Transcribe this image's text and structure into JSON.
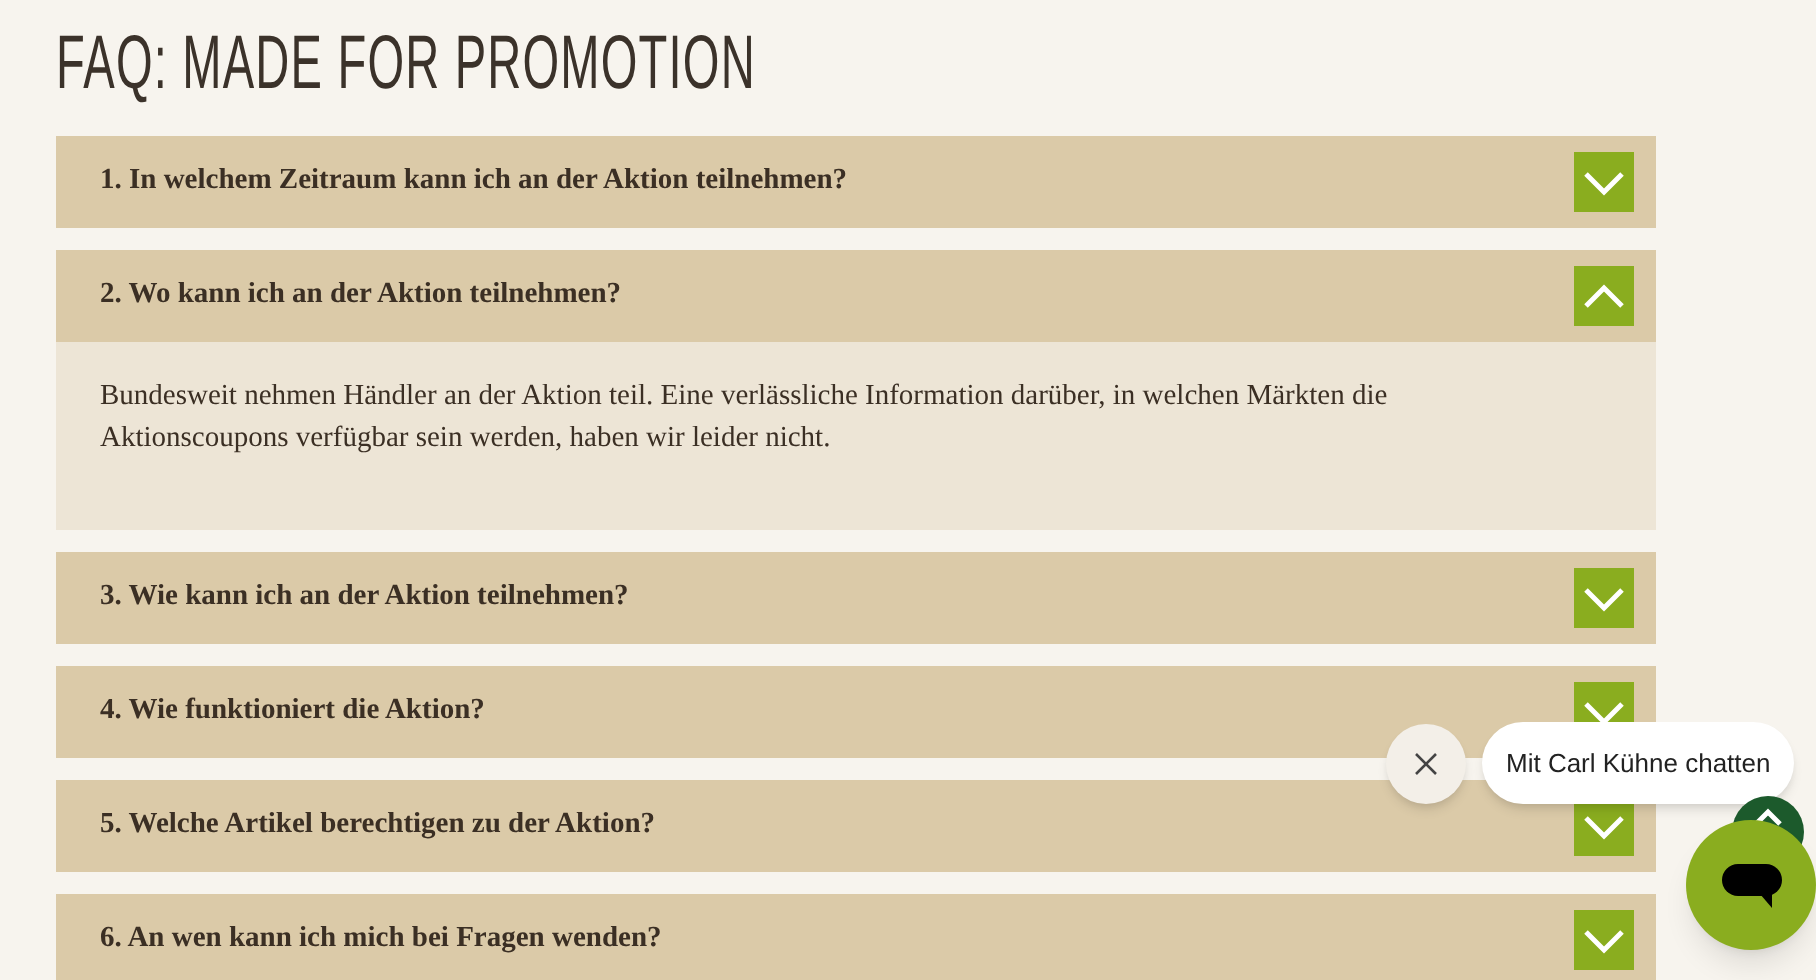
{
  "title": "FAQ: MADE FOR PROMOTION",
  "faq": [
    {
      "question": "1. In welchem Zeitraum kann ich an der Aktion teilnehmen?",
      "expanded": false
    },
    {
      "question": "2. Wo kann ich an der Aktion teilnehmen?",
      "expanded": true,
      "answer": "Bundesweit nehmen Händler an der Aktion teil. Eine verlässliche Information darüber, in welchen Märkten die Aktionscoupons verfügbar sein werden, haben wir leider nicht."
    },
    {
      "question": "3. Wie kann ich an der Aktion teilnehmen?",
      "expanded": false
    },
    {
      "question": "4. Wie funktioniert die Aktion?",
      "expanded": false
    },
    {
      "question": "5. Welche Artikel berechtigen zu der Aktion?",
      "expanded": false
    },
    {
      "question": "6. An wen kann ich mich bei Fragen wenden?",
      "expanded": false
    }
  ],
  "chat": {
    "prompt": "Mit Carl Kühne chatten"
  }
}
